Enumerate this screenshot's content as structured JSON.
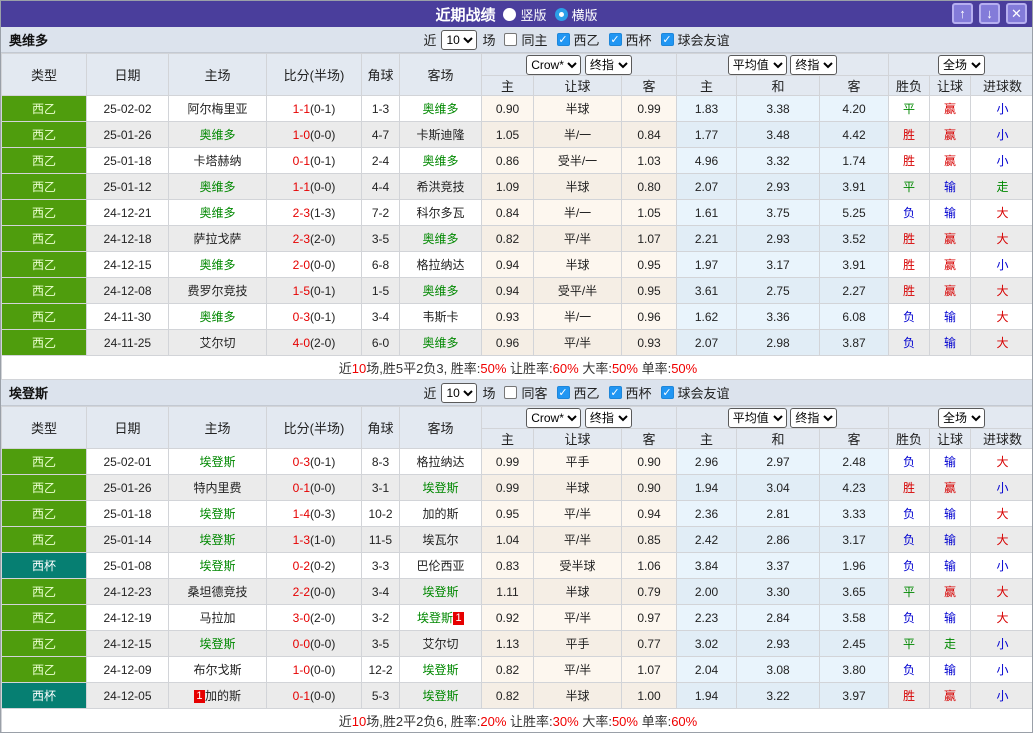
{
  "header": {
    "title": "近期战绩",
    "radio_vertical_label": "竖版",
    "radio_horizontal_label": "横版",
    "up_icon": "↑",
    "down_icon": "↓",
    "close_icon": "✕"
  },
  "controls": {
    "near": "近",
    "field": "场",
    "dd_crow": "Crow*",
    "dd_final": "终指",
    "dd_avg": "平均值",
    "dd_full": "全场"
  },
  "columns": {
    "type": "类型",
    "date": "日期",
    "home": "主场",
    "score": "比分(半场)",
    "corner": "角球",
    "away": "客场",
    "h": "主",
    "handicap": "让球",
    "a": "客",
    "avg_h": "主",
    "avg_d": "和",
    "avg_a": "客",
    "wdl": "胜负",
    "hc": "让球",
    "goals": "进球数"
  },
  "colors": {
    "titlebar": "#4a3e9c",
    "league_green": "#4f9d0d",
    "league_cup": "#067f72",
    "score_red": "#e60000",
    "focal_green": "#008800",
    "win_red": "#d70000",
    "lose_blue": "#0000d0"
  },
  "sections": [
    {
      "team": "奥维多",
      "filter": {
        "count": "10",
        "same_label": "同主",
        "same_checked": false,
        "leagues": [
          "西乙",
          "西杯",
          "球会友谊"
        ]
      },
      "rows": [
        {
          "league": "西乙",
          "league_class": "l2",
          "date": "25-02-02",
          "home": {
            "name": "阿尔梅里亚",
            "focal": false
          },
          "score_full": "1-1",
          "score_half": "(0-1)",
          "corners": "1-3",
          "away": {
            "name": "奥维多",
            "focal": true
          },
          "odds": [
            "0.90",
            "半球",
            "0.99"
          ],
          "avg": [
            "1.83",
            "3.38",
            "4.20"
          ],
          "outcome": [
            [
              "平",
              "g"
            ],
            [
              "赢",
              "r"
            ],
            [
              "小",
              "b"
            ]
          ]
        },
        {
          "league": "西乙",
          "league_class": "l2",
          "date": "25-01-26",
          "home": {
            "name": "奥维多",
            "focal": true
          },
          "score_full": "1-0",
          "score_half": "(0-0)",
          "corners": "4-7",
          "away": {
            "name": "卡斯迪隆",
            "focal": false
          },
          "odds": [
            "1.05",
            "半/一",
            "0.84"
          ],
          "avg": [
            "1.77",
            "3.48",
            "4.42"
          ],
          "outcome": [
            [
              "胜",
              "r"
            ],
            [
              "赢",
              "r"
            ],
            [
              "小",
              "b"
            ]
          ]
        },
        {
          "league": "西乙",
          "league_class": "l2",
          "date": "25-01-18",
          "home": {
            "name": "卡塔赫纳",
            "focal": false
          },
          "score_full": "0-1",
          "score_half": "(0-1)",
          "corners": "2-4",
          "away": {
            "name": "奥维多",
            "focal": true
          },
          "odds": [
            "0.86",
            "受半/一",
            "1.03"
          ],
          "avg": [
            "4.96",
            "3.32",
            "1.74"
          ],
          "outcome": [
            [
              "胜",
              "r"
            ],
            [
              "赢",
              "r"
            ],
            [
              "小",
              "b"
            ]
          ]
        },
        {
          "league": "西乙",
          "league_class": "l2",
          "date": "25-01-12",
          "home": {
            "name": "奥维多",
            "focal": true
          },
          "score_full": "1-1",
          "score_half": "(0-0)",
          "corners": "4-4",
          "away": {
            "name": "希洪竞技",
            "focal": false
          },
          "odds": [
            "1.09",
            "半球",
            "0.80"
          ],
          "avg": [
            "2.07",
            "2.93",
            "3.91"
          ],
          "outcome": [
            [
              "平",
              "g"
            ],
            [
              "输",
              "b"
            ],
            [
              "走",
              "g"
            ]
          ]
        },
        {
          "league": "西乙",
          "league_class": "l2",
          "date": "24-12-21",
          "home": {
            "name": "奥维多",
            "focal": true
          },
          "score_full": "2-3",
          "score_half": "(1-3)",
          "corners": "7-2",
          "away": {
            "name": "科尔多瓦",
            "focal": false
          },
          "odds": [
            "0.84",
            "半/一",
            "1.05"
          ],
          "avg": [
            "1.61",
            "3.75",
            "5.25"
          ],
          "outcome": [
            [
              "负",
              "b"
            ],
            [
              "输",
              "b"
            ],
            [
              "大",
              "r"
            ]
          ]
        },
        {
          "league": "西乙",
          "league_class": "l2",
          "date": "24-12-18",
          "home": {
            "name": "萨拉戈萨",
            "focal": false
          },
          "score_full": "2-3",
          "score_half": "(2-0)",
          "corners": "3-5",
          "away": {
            "name": "奥维多",
            "focal": true
          },
          "odds": [
            "0.82",
            "平/半",
            "1.07"
          ],
          "avg": [
            "2.21",
            "2.93",
            "3.52"
          ],
          "outcome": [
            [
              "胜",
              "r"
            ],
            [
              "赢",
              "r"
            ],
            [
              "大",
              "r"
            ]
          ]
        },
        {
          "league": "西乙",
          "league_class": "l2",
          "date": "24-12-15",
          "home": {
            "name": "奥维多",
            "focal": true
          },
          "score_full": "2-0",
          "score_half": "(0-0)",
          "corners": "6-8",
          "away": {
            "name": "格拉纳达",
            "focal": false
          },
          "odds": [
            "0.94",
            "半球",
            "0.95"
          ],
          "avg": [
            "1.97",
            "3.17",
            "3.91"
          ],
          "outcome": [
            [
              "胜",
              "r"
            ],
            [
              "赢",
              "r"
            ],
            [
              "小",
              "b"
            ]
          ]
        },
        {
          "league": "西乙",
          "league_class": "l2",
          "date": "24-12-08",
          "home": {
            "name": "费罗尔竞技",
            "focal": false
          },
          "score_full": "1-5",
          "score_half": "(0-1)",
          "corners": "1-5",
          "away": {
            "name": "奥维多",
            "focal": true
          },
          "odds": [
            "0.94",
            "受平/半",
            "0.95"
          ],
          "avg": [
            "3.61",
            "2.75",
            "2.27"
          ],
          "outcome": [
            [
              "胜",
              "r"
            ],
            [
              "赢",
              "r"
            ],
            [
              "大",
              "r"
            ]
          ]
        },
        {
          "league": "西乙",
          "league_class": "l2",
          "date": "24-11-30",
          "home": {
            "name": "奥维多",
            "focal": true
          },
          "score_full": "0-3",
          "score_half": "(0-1)",
          "corners": "3-4",
          "away": {
            "name": "韦斯卡",
            "focal": false
          },
          "odds": [
            "0.93",
            "半/一",
            "0.96"
          ],
          "avg": [
            "1.62",
            "3.36",
            "6.08"
          ],
          "outcome": [
            [
              "负",
              "b"
            ],
            [
              "输",
              "b"
            ],
            [
              "大",
              "r"
            ]
          ]
        },
        {
          "league": "西乙",
          "league_class": "l2",
          "date": "24-11-25",
          "home": {
            "name": "艾尔切",
            "focal": false
          },
          "score_full": "4-0",
          "score_half": "(2-0)",
          "corners": "6-0",
          "away": {
            "name": "奥维多",
            "focal": true
          },
          "odds": [
            "0.96",
            "平/半",
            "0.93"
          ],
          "avg": [
            "2.07",
            "2.98",
            "3.87"
          ],
          "outcome": [
            [
              "负",
              "b"
            ],
            [
              "输",
              "b"
            ],
            [
              "大",
              "r"
            ]
          ]
        }
      ],
      "summary": [
        [
          "近",
          0
        ],
        [
          "10",
          1
        ],
        [
          "场,胜5平2负3, 胜率:",
          0
        ],
        [
          "50%",
          1
        ],
        [
          " 让胜率:",
          0
        ],
        [
          "60%",
          1
        ],
        [
          " 大率:",
          0
        ],
        [
          "50%",
          1
        ],
        [
          " 单率:",
          0
        ],
        [
          "50%",
          1
        ]
      ]
    },
    {
      "team": "埃登斯",
      "filter": {
        "count": "10",
        "same_label": "同客",
        "same_checked": false,
        "leagues": [
          "西乙",
          "西杯",
          "球会友谊"
        ]
      },
      "rows": [
        {
          "league": "西乙",
          "league_class": "l2",
          "date": "25-02-01",
          "home": {
            "name": "埃登斯",
            "focal": true
          },
          "score_full": "0-3",
          "score_half": "(0-1)",
          "corners": "8-3",
          "away": {
            "name": "格拉纳达",
            "focal": false
          },
          "odds": [
            "0.99",
            "平手",
            "0.90"
          ],
          "avg": [
            "2.96",
            "2.97",
            "2.48"
          ],
          "outcome": [
            [
              "负",
              "b"
            ],
            [
              "输",
              "b"
            ],
            [
              "大",
              "r"
            ]
          ]
        },
        {
          "league": "西乙",
          "league_class": "l2",
          "date": "25-01-26",
          "home": {
            "name": "特内里费",
            "focal": false
          },
          "score_full": "0-1",
          "score_half": "(0-0)",
          "corners": "3-1",
          "away": {
            "name": "埃登斯",
            "focal": true
          },
          "odds": [
            "0.99",
            "半球",
            "0.90"
          ],
          "avg": [
            "1.94",
            "3.04",
            "4.23"
          ],
          "outcome": [
            [
              "胜",
              "r"
            ],
            [
              "赢",
              "r"
            ],
            [
              "小",
              "b"
            ]
          ]
        },
        {
          "league": "西乙",
          "league_class": "l2",
          "date": "25-01-18",
          "home": {
            "name": "埃登斯",
            "focal": true
          },
          "score_full": "1-4",
          "score_half": "(0-3)",
          "corners": "10-2",
          "away": {
            "name": "加的斯",
            "focal": false
          },
          "odds": [
            "0.95",
            "平/半",
            "0.94"
          ],
          "avg": [
            "2.36",
            "2.81",
            "3.33"
          ],
          "outcome": [
            [
              "负",
              "b"
            ],
            [
              "输",
              "b"
            ],
            [
              "大",
              "r"
            ]
          ]
        },
        {
          "league": "西乙",
          "league_class": "l2",
          "date": "25-01-14",
          "home": {
            "name": "埃登斯",
            "focal": true
          },
          "score_full": "1-3",
          "score_half": "(1-0)",
          "corners": "11-5",
          "away": {
            "name": "埃瓦尔",
            "focal": false
          },
          "odds": [
            "1.04",
            "平/半",
            "0.85"
          ],
          "avg": [
            "2.42",
            "2.86",
            "3.17"
          ],
          "outcome": [
            [
              "负",
              "b"
            ],
            [
              "输",
              "b"
            ],
            [
              "大",
              "r"
            ]
          ]
        },
        {
          "league": "西杯",
          "league_class": "cup",
          "date": "25-01-08",
          "home": {
            "name": "埃登斯",
            "focal": true
          },
          "score_full": "0-2",
          "score_half": "(0-2)",
          "corners": "3-3",
          "away": {
            "name": "巴伦西亚",
            "focal": false
          },
          "odds": [
            "0.83",
            "受半球",
            "1.06"
          ],
          "avg": [
            "3.84",
            "3.37",
            "1.96"
          ],
          "outcome": [
            [
              "负",
              "b"
            ],
            [
              "输",
              "b"
            ],
            [
              "小",
              "b"
            ]
          ]
        },
        {
          "league": "西乙",
          "league_class": "l2",
          "date": "24-12-23",
          "home": {
            "name": "桑坦德竞技",
            "focal": false
          },
          "score_full": "2-2",
          "score_half": "(0-0)",
          "corners": "3-4",
          "away": {
            "name": "埃登斯",
            "focal": true
          },
          "odds": [
            "1.11",
            "半球",
            "0.79"
          ],
          "avg": [
            "2.00",
            "3.30",
            "3.65"
          ],
          "outcome": [
            [
              "平",
              "g"
            ],
            [
              "赢",
              "r"
            ],
            [
              "大",
              "r"
            ]
          ]
        },
        {
          "league": "西乙",
          "league_class": "l2",
          "date": "24-12-19",
          "home": {
            "name": "马拉加",
            "focal": false
          },
          "score_full": "3-0",
          "score_half": "(2-0)",
          "corners": "3-2",
          "away": {
            "name": "埃登斯",
            "focal": true,
            "badge": "1"
          },
          "odds": [
            "0.92",
            "平/半",
            "0.97"
          ],
          "avg": [
            "2.23",
            "2.84",
            "3.58"
          ],
          "outcome": [
            [
              "负",
              "b"
            ],
            [
              "输",
              "b"
            ],
            [
              "大",
              "r"
            ]
          ]
        },
        {
          "league": "西乙",
          "league_class": "l2",
          "date": "24-12-15",
          "home": {
            "name": "埃登斯",
            "focal": true
          },
          "score_full": "0-0",
          "score_half": "(0-0)",
          "corners": "3-5",
          "away": {
            "name": "艾尔切",
            "focal": false
          },
          "odds": [
            "1.13",
            "平手",
            "0.77"
          ],
          "avg": [
            "3.02",
            "2.93",
            "2.45"
          ],
          "outcome": [
            [
              "平",
              "g"
            ],
            [
              "走",
              "g"
            ],
            [
              "小",
              "b"
            ]
          ]
        },
        {
          "league": "西乙",
          "league_class": "l2",
          "date": "24-12-09",
          "home": {
            "name": "布尔戈斯",
            "focal": false
          },
          "score_full": "1-0",
          "score_half": "(0-0)",
          "corners": "12-2",
          "away": {
            "name": "埃登斯",
            "focal": true
          },
          "odds": [
            "0.82",
            "平/半",
            "1.07"
          ],
          "avg": [
            "2.04",
            "3.08",
            "3.80"
          ],
          "outcome": [
            [
              "负",
              "b"
            ],
            [
              "输",
              "b"
            ],
            [
              "小",
              "b"
            ]
          ]
        },
        {
          "league": "西杯",
          "league_class": "cup",
          "date": "24-12-05",
          "home": {
            "name": "加的斯",
            "focal": false,
            "badge": "1"
          },
          "score_full": "0-1",
          "score_half": "(0-0)",
          "corners": "5-3",
          "away": {
            "name": "埃登斯",
            "focal": true
          },
          "odds": [
            "0.82",
            "半球",
            "1.00"
          ],
          "avg": [
            "1.94",
            "3.22",
            "3.97"
          ],
          "outcome": [
            [
              "胜",
              "r"
            ],
            [
              "赢",
              "r"
            ],
            [
              "小",
              "b"
            ]
          ]
        }
      ],
      "summary": [
        [
          "近",
          0
        ],
        [
          "10",
          1
        ],
        [
          "场,胜2平2负6, 胜率:",
          0
        ],
        [
          "20%",
          1
        ],
        [
          " 让胜率:",
          0
        ],
        [
          "30%",
          1
        ],
        [
          " 大率:",
          0
        ],
        [
          "50%",
          1
        ],
        [
          " 单率:",
          0
        ],
        [
          "60%",
          1
        ]
      ]
    }
  ]
}
